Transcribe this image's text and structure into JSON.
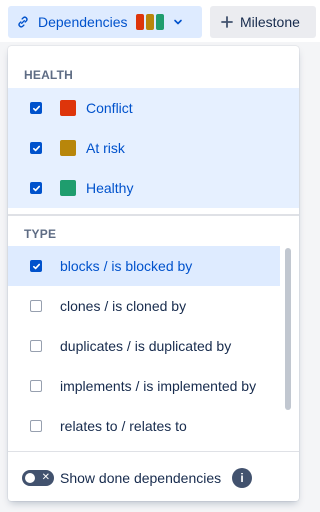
{
  "toolbar": {
    "dependencies_label": "Dependencies",
    "milestone_label": "Milestone",
    "swatch_colors": [
      "#de350b",
      "#b8860b",
      "#1f9d6e"
    ]
  },
  "dropdown": {
    "health_title": "HEALTH",
    "health_options": [
      {
        "label": "Conflict",
        "color": "#de350b",
        "checked": true
      },
      {
        "label": "At risk",
        "color": "#b8860b",
        "checked": true
      },
      {
        "label": "Healthy",
        "color": "#1f9d6e",
        "checked": true
      }
    ],
    "type_title": "TYPE",
    "type_options": [
      {
        "label": "blocks / is blocked by",
        "checked": true
      },
      {
        "label": "clones / is cloned by",
        "checked": false
      },
      {
        "label": "duplicates / is duplicated by",
        "checked": false
      },
      {
        "label": "implements / is implemented by",
        "checked": false
      },
      {
        "label": "relates to / relates to",
        "checked": false
      }
    ],
    "footer": {
      "toggle_label": "Show done dependencies",
      "toggle_on": false,
      "info_glyph": "i"
    }
  }
}
